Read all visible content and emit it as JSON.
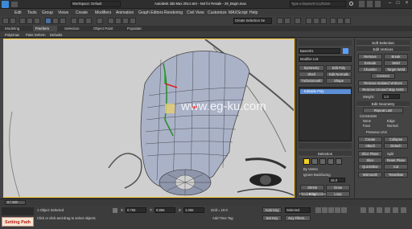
{
  "titlebar": {
    "workspace": "Workspace: Default",
    "app_title": "Autodesk 3ds Max 2014 x64 - Not for Resale - 29_Begin.max",
    "search_placeholder": "Type a keyword or phrase"
  },
  "menu": [
    "Edit",
    "Tools",
    "Group",
    "Views",
    "Create",
    "Modifiers",
    "Animation",
    "Graph Editors",
    "Rendering",
    "Civil View",
    "Customize",
    "MAXScript",
    "Help"
  ],
  "toolbar": {
    "selection_set": "Create Selection Se"
  },
  "ribbon": {
    "tabs": [
      "Modeling",
      "Freeform",
      "Selection",
      "Object Paint",
      "Populate"
    ],
    "subtabs": [
      "PolyDraw",
      "Paint Deform",
      "Defaults"
    ]
  },
  "viewport": {
    "watermark": "www.eg-ku.com"
  },
  "command_panel": {
    "object_name": "Base001",
    "modifier_list": "Modifier List",
    "buttons": [
      "Symmetry",
      "Edit Poly",
      "Shell",
      "Edit Normals",
      "TurboSmooth",
      "Shape"
    ],
    "stack_item": "Editable Poly",
    "selection_header": "Selection",
    "by_vertex": "By Vertex",
    "ignore_backfacing": "Ignore Backfacing",
    "angle_value": "45.0",
    "shrink": "Shrink",
    "grow": "Grow",
    "ring": "Ring",
    "loop": "Loop",
    "preview_header": "Preview Selection",
    "preview_off": "Off",
    "preview_subobj": "SubObj",
    "preview_multi": "Multi"
  },
  "right_panel": {
    "soft_selection": "Soft Selection",
    "edit_vertices": "Edit Vertices",
    "remove": "Remove",
    "break": "Break",
    "extrude": "Extrude",
    "weld": "Weld",
    "chamfer": "Chamfer",
    "target_weld": "Target Weld",
    "connect": "Connect",
    "remove_isolated": "Remove Isolated Vertices",
    "remove_unused": "Remove Unused Map Verts",
    "weight_label": "Weight:",
    "weight_value": "1.0",
    "edit_geometry": "Edit Geometry",
    "repeat_last": "Repeat Last",
    "constraints": "Constraints",
    "none": "None",
    "edge": "Edge",
    "face": "Face",
    "normal": "Normal",
    "preserve_uvs": "Preserve UVs",
    "create": "Create",
    "collapse": "Collapse",
    "attach": "Attach",
    "detach": "Detach",
    "slice_plane": "Slice Plane",
    "split": "Split",
    "slice": "Slice",
    "reset_plane": "Reset Plane",
    "quickslice": "QuickSlice",
    "cut": "Cut",
    "msmooth": "MSmooth",
    "tessellate": "Tessellate"
  },
  "timeline": {
    "frame": "0 / 100"
  },
  "status": {
    "selected": "1 Object Selected",
    "prompt": "Click or click-and-drag to select objects",
    "x_label": "X:",
    "x_value": "0.756",
    "y_label": "Y:",
    "y_value": "0.856",
    "z_label": "Z:",
    "z_value": "1.055",
    "grid": "Grid = 10.0",
    "add_time_tag": "Add Time Tag",
    "auto_key": "Auto Key",
    "set_key": "Set Key",
    "selected_dropdown": "Selected",
    "key_filters": "Key Filters..."
  },
  "badge": "Setting Path",
  "colors": {
    "accent": "#3a8ad8",
    "viewport_border": "#ffcc33",
    "badge_text": "#c21818"
  }
}
